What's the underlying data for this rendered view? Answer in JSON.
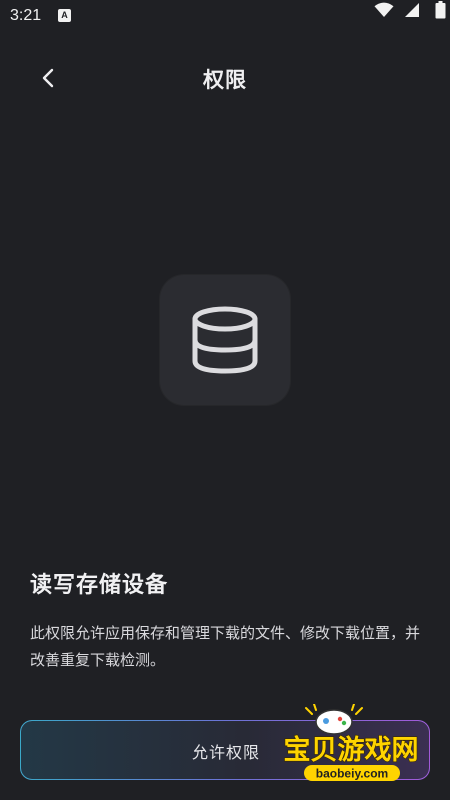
{
  "status_bar": {
    "time": "3:21",
    "notification_icon": "a-letter-icon",
    "icons": [
      "wifi-icon",
      "signal-icon",
      "battery-icon"
    ]
  },
  "header": {
    "back_icon": "chevron-left-icon",
    "title": "权限"
  },
  "permission": {
    "icon": "database-icon",
    "title": "读写存储设备",
    "description": "此权限允许应用保存和管理下载的文件、修改下载位置，并改善重复下载检测。"
  },
  "actions": {
    "allow_label": "允许权限"
  },
  "watermark": {
    "brand": "宝贝游戏网",
    "url": "baobeiy.com"
  },
  "colors": {
    "background": "#1f2024",
    "tile": "#2b2c31",
    "text": "#efeff1",
    "button_gradient_start": "#3ba9c9",
    "button_gradient_end": "#a25ad9",
    "watermark_yellow": "#ffd400"
  }
}
